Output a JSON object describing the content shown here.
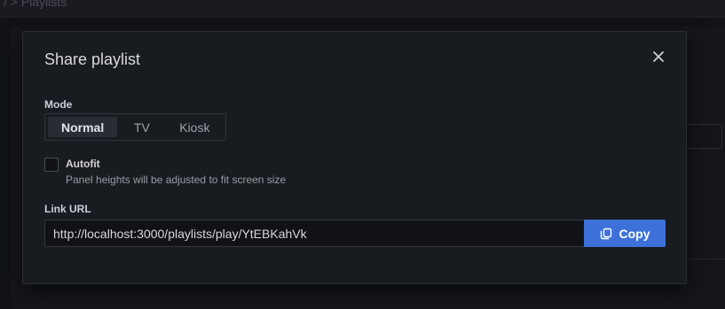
{
  "background": {
    "breadcrumb": "/ > Playlists"
  },
  "dialog": {
    "title": "Share playlist",
    "close_icon": "close-icon",
    "mode": {
      "label": "Mode",
      "options": [
        "Normal",
        "TV",
        "Kiosk"
      ],
      "selected": "Normal"
    },
    "autofit": {
      "label": "Autofit",
      "description": "Panel heights will be adjusted to fit screen size",
      "checked": false
    },
    "link_url": {
      "label": "Link URL",
      "value": "http://localhost:3000/playlists/play/YtEBKahVk"
    },
    "copy_button": {
      "label": "Copy",
      "icon": "copy-icon"
    }
  },
  "colors": {
    "accent": "#3d71d9",
    "modal_bg": "#181b1f",
    "page_bg": "#111217"
  }
}
